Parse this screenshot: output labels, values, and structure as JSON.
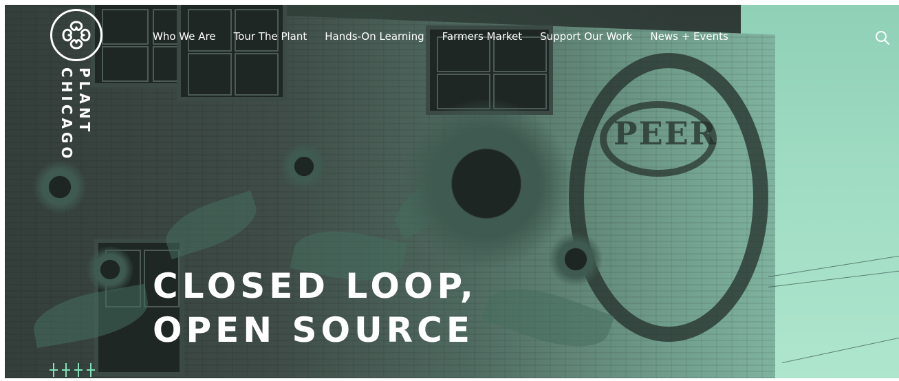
{
  "brand": {
    "logo_icon": "plant-chicago-knot-icon",
    "word_1": "PLANT",
    "word_2": "CHICAGO"
  },
  "nav": {
    "items": [
      {
        "label": "Who We Are"
      },
      {
        "label": "Tour The Plant"
      },
      {
        "label": "Hands-On Learning"
      },
      {
        "label": "Farmers Market"
      },
      {
        "label": "Support Our Work"
      },
      {
        "label": "News + Events"
      }
    ],
    "search_icon": "search-icon"
  },
  "hero": {
    "headline_line1": "CLOSED LOOP,",
    "headline_line2": "OPEN SOURCE",
    "mural_text": "PEER",
    "tint_color": "#8fd0b6",
    "accent_color": "#2f3a36"
  },
  "footer_badge": {
    "icon": "crosses-pattern-icon"
  }
}
